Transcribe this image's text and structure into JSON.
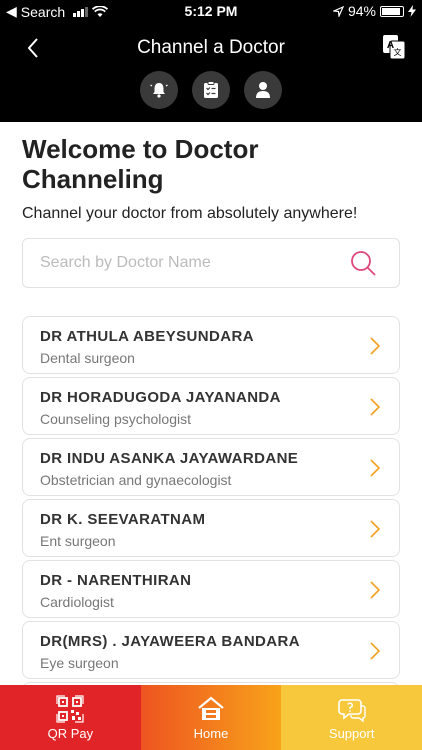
{
  "status_bar": {
    "carrier": "Search",
    "time": "5:12 PM",
    "battery": "94%"
  },
  "nav": {
    "title": "Channel a Doctor",
    "icons": [
      "bell-icon",
      "clipboard-icon",
      "person-icon"
    ]
  },
  "welcome": {
    "title": "Welcome to Doctor Channeling",
    "subtitle": "Channel your doctor from absolutely anywhere!"
  },
  "search": {
    "placeholder": "Search by Doctor Name",
    "value": ""
  },
  "doctors": [
    {
      "name": "DR ATHULA ABEYSUNDARA",
      "specialty": "Dental surgeon"
    },
    {
      "name": "DR HORADUGODA JAYANANDA",
      "specialty": "Counseling psychologist"
    },
    {
      "name": "DR INDU ASANKA JAYAWARDANE",
      "specialty": "Obstetrician and gynaecologist"
    },
    {
      "name": "DR K. SEEVARATNAM",
      "specialty": "Ent surgeon"
    },
    {
      "name": "DR - NARENTHIRAN",
      "specialty": "Cardiologist"
    },
    {
      "name": "DR(MRS) . JAYAWEERA BANDARA",
      "specialty": "Eye surgeon"
    }
  ],
  "tabs": {
    "qr_pay": "QR Pay",
    "home": "Home",
    "support": "Support"
  },
  "colors": {
    "accent_search": "#e0457b",
    "chevron": "#f2a020",
    "tab_qr": "#e02427",
    "tab_home": "#f47a1f",
    "tab_support": "#f7c83c"
  }
}
